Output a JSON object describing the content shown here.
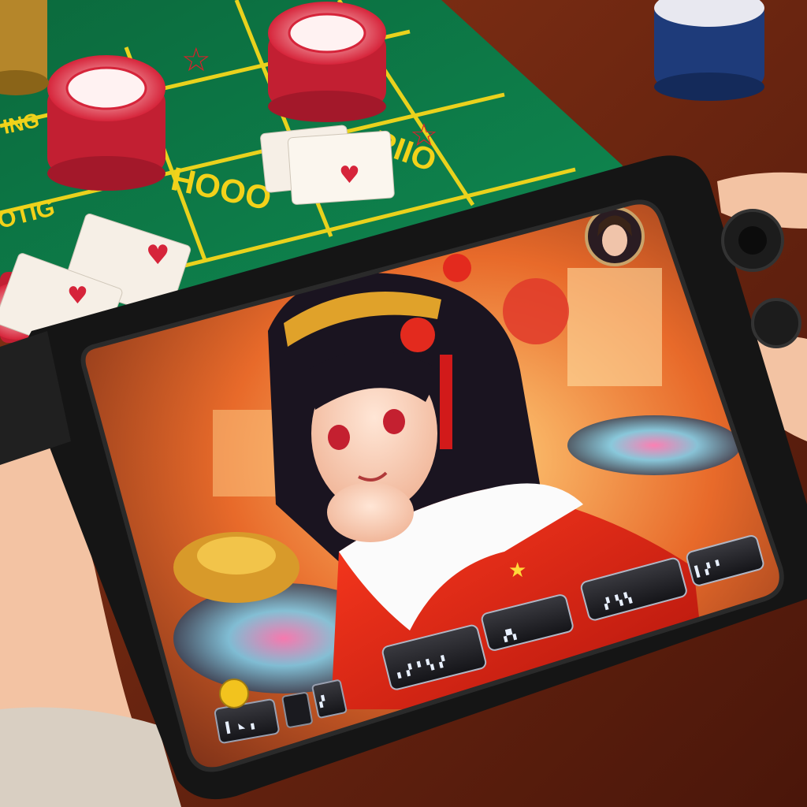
{
  "scene": {
    "description_free": true,
    "table_markings": [
      "ING",
      "OTIG",
      "RIIO",
      "HOOO"
    ],
    "avatar": {
      "icon": "player-avatar-icon"
    },
    "hud_panels": [
      {
        "name": "panel-bottom-left",
        "icon": "panel-glyph-icon"
      },
      {
        "name": "panel-coin-slot",
        "icon": "coin-icon"
      },
      {
        "name": "panel-center",
        "icon": "panel-glyph-icon"
      },
      {
        "name": "panel-mid",
        "icon": "panel-glyph-icon"
      },
      {
        "name": "panel-right",
        "icon": "panel-glyph-icon"
      },
      {
        "name": "panel-far-right",
        "icon": "panel-glyph-icon"
      }
    ],
    "colors": {
      "felt": "#0f7a48",
      "felt_line": "#e9d21d",
      "chip_red": "#d6243a",
      "screen_glow": "#ff8a3c",
      "device": "#151515"
    }
  }
}
